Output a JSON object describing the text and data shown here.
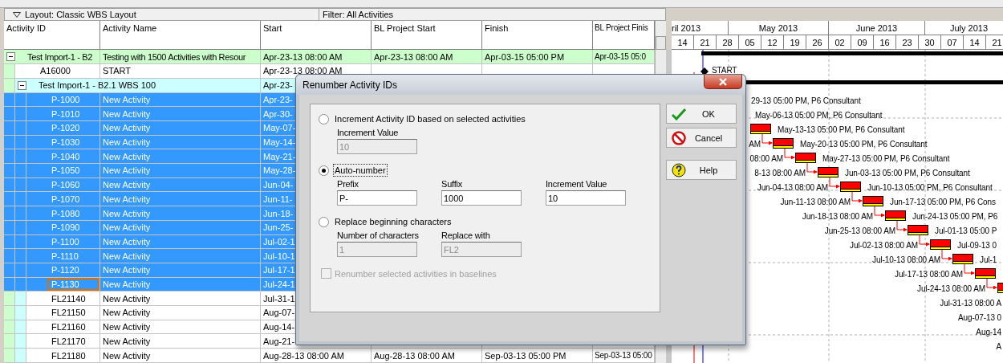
{
  "layout_bar": {
    "layout": "Layout: Classic WBS Layout",
    "filter": "Filter: All Activities"
  },
  "table": {
    "columns": [
      "Activity ID",
      "Activity Name",
      "Start",
      "BL Project Start",
      "Finish",
      "BL Project Finis"
    ],
    "rows": [
      {
        "kind": "wbs",
        "id": "Test Import-1 - B2",
        "name": "Testing with 1500 Activities with Resour",
        "start": "Apr-23-13 08:00 AM",
        "bl_start": "Apr-23-13 08:00 AM",
        "finish": "Apr-03-15 05:00 PM",
        "bl_finish": "Apr-03-15 05:0",
        "expanded": true,
        "children": [
          {
            "kind": "activity",
            "id": "A16000",
            "name": "START",
            "start": "Apr-23-13 08:00 AM",
            "selected": false,
            "focused": false
          },
          {
            "kind": "wbs",
            "id": "Test Import-1 - B2.1  WBS 100",
            "start": "Apr-23-",
            "expanded": true,
            "children": [
              {
                "kind": "activity",
                "id": "P-1000",
                "name": "New Activity",
                "start": "Apr-23-",
                "selected": true,
                "focused": false
              },
              {
                "kind": "activity",
                "id": "P-1010",
                "name": "New Activity",
                "start": "Apr-30-",
                "selected": true,
                "focused": false
              },
              {
                "kind": "activity",
                "id": "P-1020",
                "name": "New Activity",
                "start": "May-07-",
                "selected": true,
                "focused": false
              },
              {
                "kind": "activity",
                "id": "P-1030",
                "name": "New Activity",
                "start": "May-14-",
                "selected": true,
                "focused": false
              },
              {
                "kind": "activity",
                "id": "P-1040",
                "name": "New Activity",
                "start": "May-21-",
                "selected": true,
                "focused": false
              },
              {
                "kind": "activity",
                "id": "P-1050",
                "name": "New Activity",
                "start": "May-28-",
                "selected": true,
                "focused": false
              },
              {
                "kind": "activity",
                "id": "P-1060",
                "name": "New Activity",
                "start": "Jun-04-",
                "selected": true,
                "focused": false
              },
              {
                "kind": "activity",
                "id": "P-1070",
                "name": "New Activity",
                "start": "Jun-11-",
                "selected": true,
                "focused": false
              },
              {
                "kind": "activity",
                "id": "P-1080",
                "name": "New Activity",
                "start": "Jun-18-",
                "selected": true,
                "focused": false
              },
              {
                "kind": "activity",
                "id": "P-1090",
                "name": "New Activity",
                "start": "Jun-25-",
                "selected": true,
                "focused": false
              },
              {
                "kind": "activity",
                "id": "P-1100",
                "name": "New Activity",
                "start": "Jul-02-1",
                "selected": true,
                "focused": false
              },
              {
                "kind": "activity",
                "id": "P-1110",
                "name": "New Activity",
                "start": "Jul-10-1",
                "selected": true,
                "focused": false
              },
              {
                "kind": "activity",
                "id": "P-1120",
                "name": "New Activity",
                "start": "Jul-17-1",
                "selected": true,
                "focused": false
              },
              {
                "kind": "activity",
                "id": "P-1130",
                "name": "New Activity",
                "start": "Jul-24-1",
                "selected": true,
                "focused": true
              },
              {
                "kind": "activity",
                "id": "FL21140",
                "name": "New Activity",
                "start": "Jul-31-1",
                "selected": false,
                "focused": false
              },
              {
                "kind": "activity",
                "id": "FL21150",
                "name": "New Activity",
                "start": "Aug-07-",
                "selected": false,
                "focused": false
              },
              {
                "kind": "activity",
                "id": "FL21160",
                "name": "New Activity",
                "start": "Aug-14-",
                "selected": false,
                "focused": false
              },
              {
                "kind": "activity",
                "id": "FL21170",
                "name": "New Activity",
                "start": "Aug-21-",
                "selected": false,
                "focused": false
              },
              {
                "kind": "activity",
                "id": "FL21180",
                "name": "New Activity",
                "start": "Aug-28-13 08:00 AM",
                "bl_start": "Aug-28-13 08:00 AM",
                "finish": "Sep-03-13 05:00 PM",
                "bl_finish": "Sep-03-13 05:00",
                "selected": false,
                "focused": false
              }
            ]
          }
        ]
      }
    ]
  },
  "gantt": {
    "months": [
      "ril 2013",
      "May 2013",
      "June 2013",
      "July 2013"
    ],
    "weeks": [
      "14",
      "21",
      "28",
      "05",
      "12",
      "19",
      "26",
      "02",
      "09",
      "16",
      "23",
      "30",
      "07",
      "14",
      "21"
    ],
    "bars": [
      {
        "kind": "summary"
      },
      {
        "kind": "milestone",
        "label": "START"
      },
      {
        "kind": "summary"
      },
      {
        "kind": "task",
        "finish_label": "29-13 05:00 PM, P6 Consultant"
      },
      {
        "kind": "task",
        "finish_label": "May-06-13 05:00 PM, P6 Consultant"
      },
      {
        "kind": "task",
        "finish_label": "May-13-13 05:00 PM, P6 Consultant"
      },
      {
        "kind": "task",
        "start_label": "AM",
        "finish_label": "May-20-13 05:00 PM, P6 Consultant"
      },
      {
        "kind": "task",
        "start_label": "08:00 AM",
        "finish_label": "May-27-13 05:00 PM, P6 Consultant"
      },
      {
        "kind": "task",
        "start_label": "8-13 08:00 AM",
        "finish_label": "Jun-03-13 05:00 PM, P6 Consultant"
      },
      {
        "kind": "task",
        "start_label": "Jun-04-13 08:00 AM",
        "finish_label": "Jun-10-13 05:00 PM, P6 Consultant"
      },
      {
        "kind": "task",
        "start_label": "Jun-11-13 08:00 AM",
        "finish_label": "Jun-17-13 05:00 PM, P6 Cons"
      },
      {
        "kind": "task",
        "start_label": "Jun-18-13 08:00 AM",
        "finish_label": "Jun-24-13 05:00 PM, P6"
      },
      {
        "kind": "task",
        "start_label": "Jun-25-13 08:00 AM",
        "finish_label": "Jul-01-13 05:00 P"
      },
      {
        "kind": "task",
        "start_label": "Jul-02-13 08:00 AM",
        "finish_label": "Jul-09-13 0"
      },
      {
        "kind": "task",
        "start_label": "Jul-10-13 08:00 AM",
        "finish_label": "Jul-1"
      },
      {
        "kind": "task",
        "start_label": "Jul-17-13 08:00 AM"
      },
      {
        "kind": "task",
        "start_label": "Jul-24-13 08:00 AM"
      },
      {
        "kind": "task",
        "start_label": "Jul-31-13 08:00 A"
      },
      {
        "kind": "task",
        "start_label": "Aug-07-13 0"
      },
      {
        "kind": "task",
        "start_label": "Aug-14"
      },
      {
        "kind": "task",
        "start_label": "A"
      }
    ]
  },
  "dialog": {
    "title": "Renumber Activity IDs",
    "options": [
      {
        "label": "Increment Activity ID based on selected activities",
        "selected": false,
        "fields": [
          {
            "label": "Increment Value",
            "value": "10",
            "disabled": true
          }
        ]
      },
      {
        "label": "Auto-number",
        "selected": true,
        "fields": [
          {
            "label": "Prefix",
            "value": "P-",
            "disabled": false
          },
          {
            "label": "Suffix",
            "value": "1000",
            "disabled": false
          },
          {
            "label": "Increment Value",
            "value": "10",
            "disabled": false
          }
        ]
      },
      {
        "label": "Replace beginning characters",
        "selected": false,
        "fields": [
          {
            "label": "Number of characters",
            "value": "1",
            "disabled": true
          },
          {
            "label": "Replace with",
            "value": "FL2",
            "disabled": true
          }
        ]
      }
    ],
    "checkbox": {
      "label": "Renumber selected activities in baselines",
      "checked": false,
      "disabled": true
    },
    "buttons": [
      {
        "kind": "ok",
        "label": "OK"
      },
      {
        "kind": "cancel",
        "label": "Cancel"
      },
      {
        "kind": "help",
        "label": "Help"
      }
    ]
  }
}
